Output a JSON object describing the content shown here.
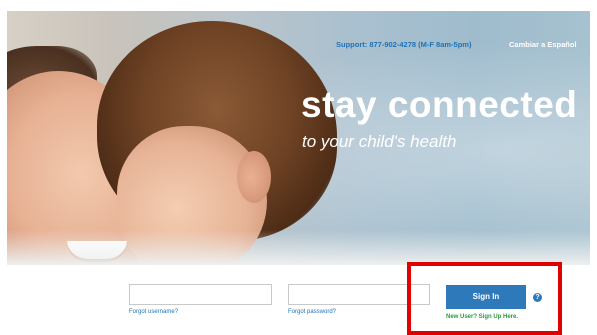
{
  "header": {
    "support_text": "Support: 877-902-4278 (M-F 8am-5pm)",
    "language_link": "Cambiar a Español"
  },
  "hero": {
    "headline": "stay connected",
    "subline": "to your child's health"
  },
  "login": {
    "username_value": "",
    "password_value": "",
    "forgot_username": "Forgot username?",
    "forgot_password": "Forgot password?",
    "sign_in_label": "Sign In",
    "help_icon": "?",
    "sign_up_link": "New User? Sign Up Here."
  },
  "colors": {
    "brand_blue": "#2e79b9",
    "link_blue": "#1f73b7",
    "signup_green": "#2c9a3a",
    "highlight_red": "#e00000"
  },
  "icons": {
    "help": "help-icon"
  }
}
